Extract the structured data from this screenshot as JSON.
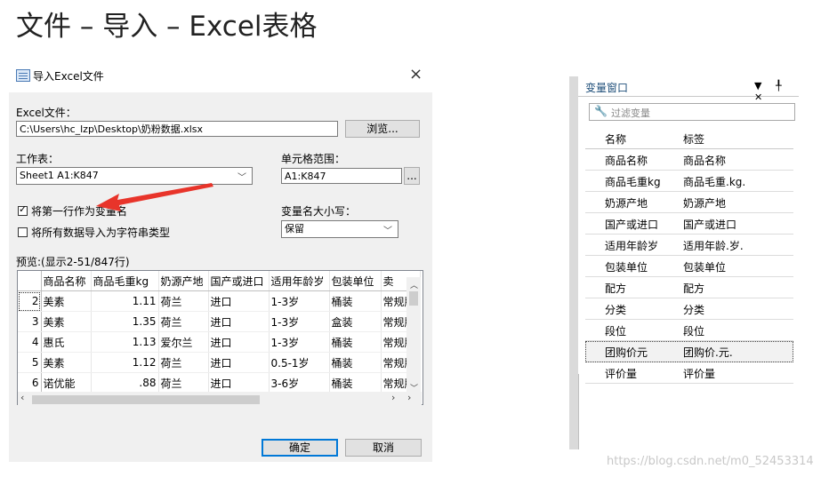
{
  "heading": "文件 – 导入 – Excel表格",
  "dialog": {
    "title": "导入Excel文件",
    "close": "×",
    "file_label": "Excel文件：",
    "file_value": "C:\\Users\\hc_lzp\\Desktop\\奶粉数据.xlsx",
    "browse": "浏览...",
    "sheet_label": "工作表：",
    "sheet_value": "Sheet1 A1:K847",
    "range_label": "单元格范围：",
    "range_value": "A1:K847",
    "range_btn": "...",
    "checkbox1": "将第一行作为变量名",
    "checkbox2": "将所有数据导入为字符串类型",
    "case_label": "变量名大小写：",
    "case_value": "保留",
    "preview_label": "预览:(显示2-51/847行)",
    "ok": "确定",
    "cancel": "取消"
  },
  "preview": {
    "headers": [
      "商品名称",
      "商品毛重kg",
      "奶源产地",
      "国产或进口",
      "适用年龄岁",
      "包装单位",
      "卖"
    ],
    "rows": [
      {
        "n": "2",
        "c": [
          "美素",
          "1.11",
          "荷兰",
          "进口",
          "1-3岁",
          "桶装",
          "常规版"
        ]
      },
      {
        "n": "3",
        "c": [
          "美素",
          "1.35",
          "荷兰",
          "进口",
          "1-3岁",
          "盒装",
          "常规版"
        ]
      },
      {
        "n": "4",
        "c": [
          "惠氏",
          "1.13",
          "爱尔兰",
          "进口",
          "1-3岁",
          "桶装",
          "常规版"
        ]
      },
      {
        "n": "5",
        "c": [
          "美素",
          "1.12",
          "荷兰",
          "进口",
          "0.5-1岁",
          "桶装",
          "常规版"
        ]
      },
      {
        "n": "6",
        "c": [
          "诺优能",
          ".88",
          "荷兰",
          "进口",
          "3-6岁",
          "桶装",
          "常规版"
        ]
      }
    ]
  },
  "var_panel": {
    "title": "变量窗口",
    "icons": "▼ ╀ ✕",
    "filter_placeholder": "过滤变量",
    "col_name": "名称",
    "col_label": "标签",
    "vars": [
      {
        "name": "商品名称",
        "label": "商品名称"
      },
      {
        "name": "商品毛重kg",
        "label": "商品毛重.kg."
      },
      {
        "name": "奶源产地",
        "label": "奶源产地"
      },
      {
        "name": "国产或进口",
        "label": "国产或进口"
      },
      {
        "name": "适用年龄岁",
        "label": "适用年龄.岁."
      },
      {
        "name": "包装单位",
        "label": "包装单位"
      },
      {
        "name": "配方",
        "label": "配方"
      },
      {
        "name": "分类",
        "label": "分类"
      },
      {
        "name": "段位",
        "label": "段位"
      },
      {
        "name": "团购价元",
        "label": "团购价.元."
      },
      {
        "name": "评价量",
        "label": "评价量"
      }
    ]
  },
  "watermark": "https://blog.csdn.net/m0_52453314",
  "colors": {
    "arrow": "#e8342a",
    "accent": "#0078d7"
  }
}
